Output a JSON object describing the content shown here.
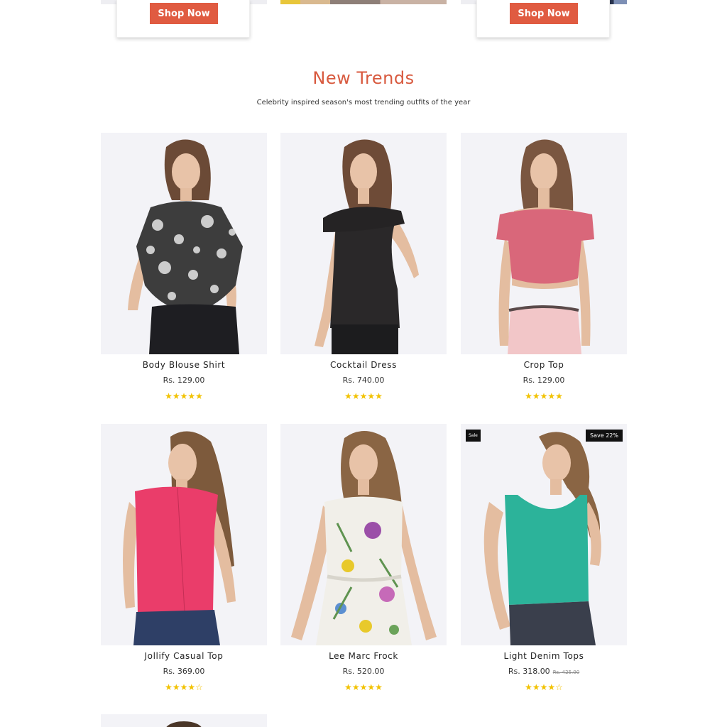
{
  "promo": {
    "left_button": "Shop Now",
    "right_button": "Shop Now"
  },
  "section": {
    "title": "New Trends",
    "subtitle": "Celebrity inspired season's most trending outfits of the year"
  },
  "products": [
    {
      "name": "Body Blouse Shirt",
      "price": "Rs. 129.00",
      "rating": 5,
      "rating_text": "★★★★★",
      "top_color": "#3b3b3b",
      "pattern": "floral-bw",
      "bottom_color": "#1e1e22"
    },
    {
      "name": "Cocktail Dress",
      "price": "Rs. 740.00",
      "rating": 5,
      "rating_text": "★★★★★",
      "top_color": "#2a2829",
      "pattern": "solid",
      "bottom_color": "#1c1c1e"
    },
    {
      "name": "Crop Top",
      "price": "Rs. 129.00",
      "rating": 5,
      "rating_text": "★★★★★",
      "top_color": "#d9677a",
      "pattern": "solid",
      "bottom_color": "#f2c6c8"
    },
    {
      "name": "Jollify Casual Top",
      "price": "Rs. 369.00",
      "rating": 4,
      "rating_text": "★★★★☆",
      "top_color": "#ea3d6a",
      "pattern": "solid",
      "bottom_color": "#2e3f66"
    },
    {
      "name": "Lee Marc Frock",
      "price": "Rs. 520.00",
      "rating": 5,
      "rating_text": "★★★★★",
      "top_color": "#f1efe9",
      "pattern": "floral-color",
      "bottom_color": "#f1efe9"
    },
    {
      "name": "Light Denim Tops",
      "price": "Rs. 318.00",
      "old_price": "Rs. 425.00",
      "rating": 4,
      "rating_text": "★★★★☆",
      "top_color": "#2cb39a",
      "pattern": "solid",
      "bottom_color": "#3a3f4c",
      "badge_sale": "Sale",
      "badge_save": "Save 22%"
    }
  ],
  "colors": {
    "accent": "#e05b41",
    "title": "#d85a3f",
    "star": "#f2c200",
    "card_bg": "#f3f3f7"
  }
}
